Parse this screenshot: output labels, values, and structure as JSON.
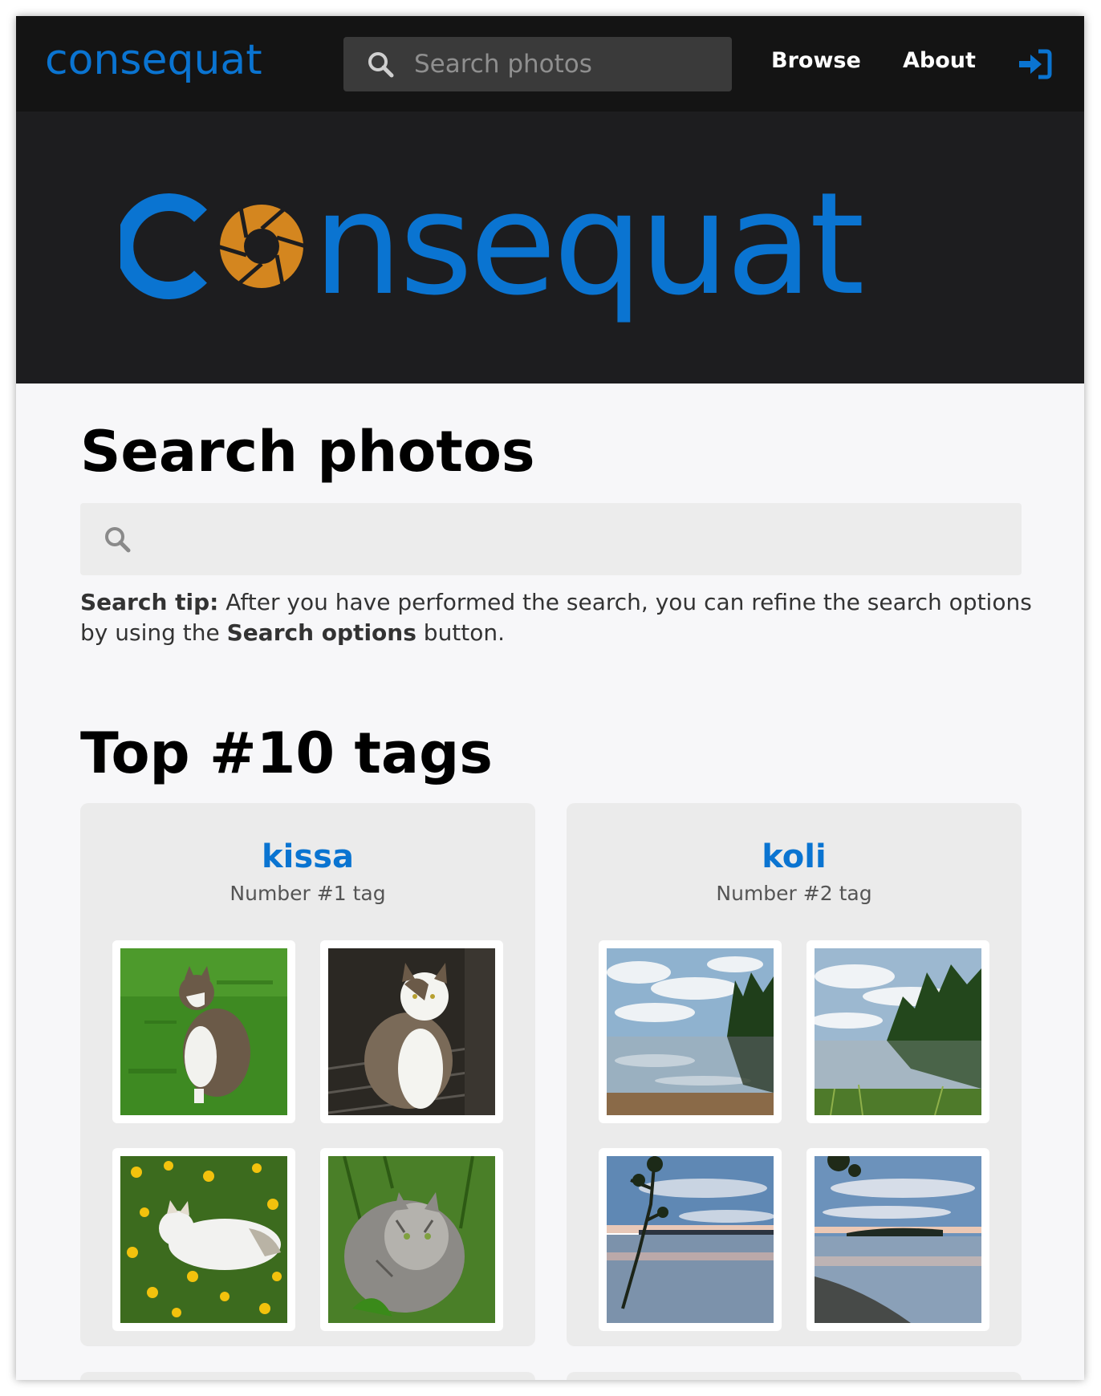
{
  "nav": {
    "logo_text": "consequat",
    "search_placeholder": "Search photos",
    "links": [
      "Browse",
      "About"
    ],
    "login_icon": "sign-in-icon"
  },
  "banner": {
    "logo_text": "consequat"
  },
  "search_section": {
    "title": "Search photos",
    "input_value": "",
    "tip_label": "Search tip:",
    "tip_text_1": " After you have performed the search, you can refine the search options by using the ",
    "tip_button_name": "Search options",
    "tip_text_2": " button."
  },
  "tags_section": {
    "title": "Top #10 tags",
    "tags": [
      {
        "name": "kissa",
        "rank": "Number #1 tag"
      },
      {
        "name": "koli",
        "rank": "Number #2 tag"
      }
    ]
  },
  "colors": {
    "brand_blue": "#0a74d1",
    "brand_orange": "#d4861f",
    "nav_bg": "#141414",
    "banner_bg": "#1d1d1f"
  }
}
